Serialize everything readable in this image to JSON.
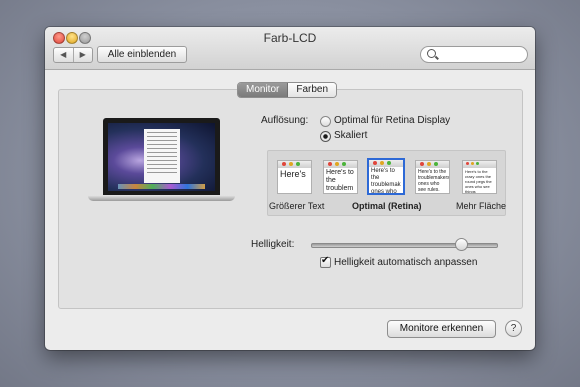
{
  "window": {
    "title": "Farb-LCD"
  },
  "toolbar": {
    "back_glyph": "◀",
    "forward_glyph": "▶",
    "show_all_label": "Alle einblenden",
    "search_placeholder": ""
  },
  "tabs": [
    {
      "label": "Monitor",
      "active": true
    },
    {
      "label": "Farben",
      "active": false
    }
  ],
  "resolution": {
    "label": "Auflösung:",
    "options": [
      {
        "label": "Optimal für Retina Display",
        "selected": false
      },
      {
        "label": "Skaliert",
        "selected": true
      }
    ],
    "scale_thumbs": [
      {
        "text": "Here's",
        "selected": false
      },
      {
        "text": "Here's to the troublem",
        "selected": false
      },
      {
        "text": "Here's to the troublemak ones who",
        "selected": true
      },
      {
        "text": "Here's to the troublemakers ones who see rules. And the",
        "selected": false
      },
      {
        "text": "Here's to the crazy ones the round pegs the ones who see things differently they're not fond of rules",
        "selected": false
      }
    ],
    "captions": {
      "larger": "Größerer Text",
      "optimal": "Optimal (Retina)",
      "more": "Mehr Fläche"
    }
  },
  "brightness": {
    "label": "Helligkeit:",
    "value": 0.81,
    "auto_label": "Helligkeit automatisch anpassen",
    "auto_checked": true
  },
  "footer": {
    "detect_label": "Monitore erkennen",
    "help_label": "?"
  }
}
